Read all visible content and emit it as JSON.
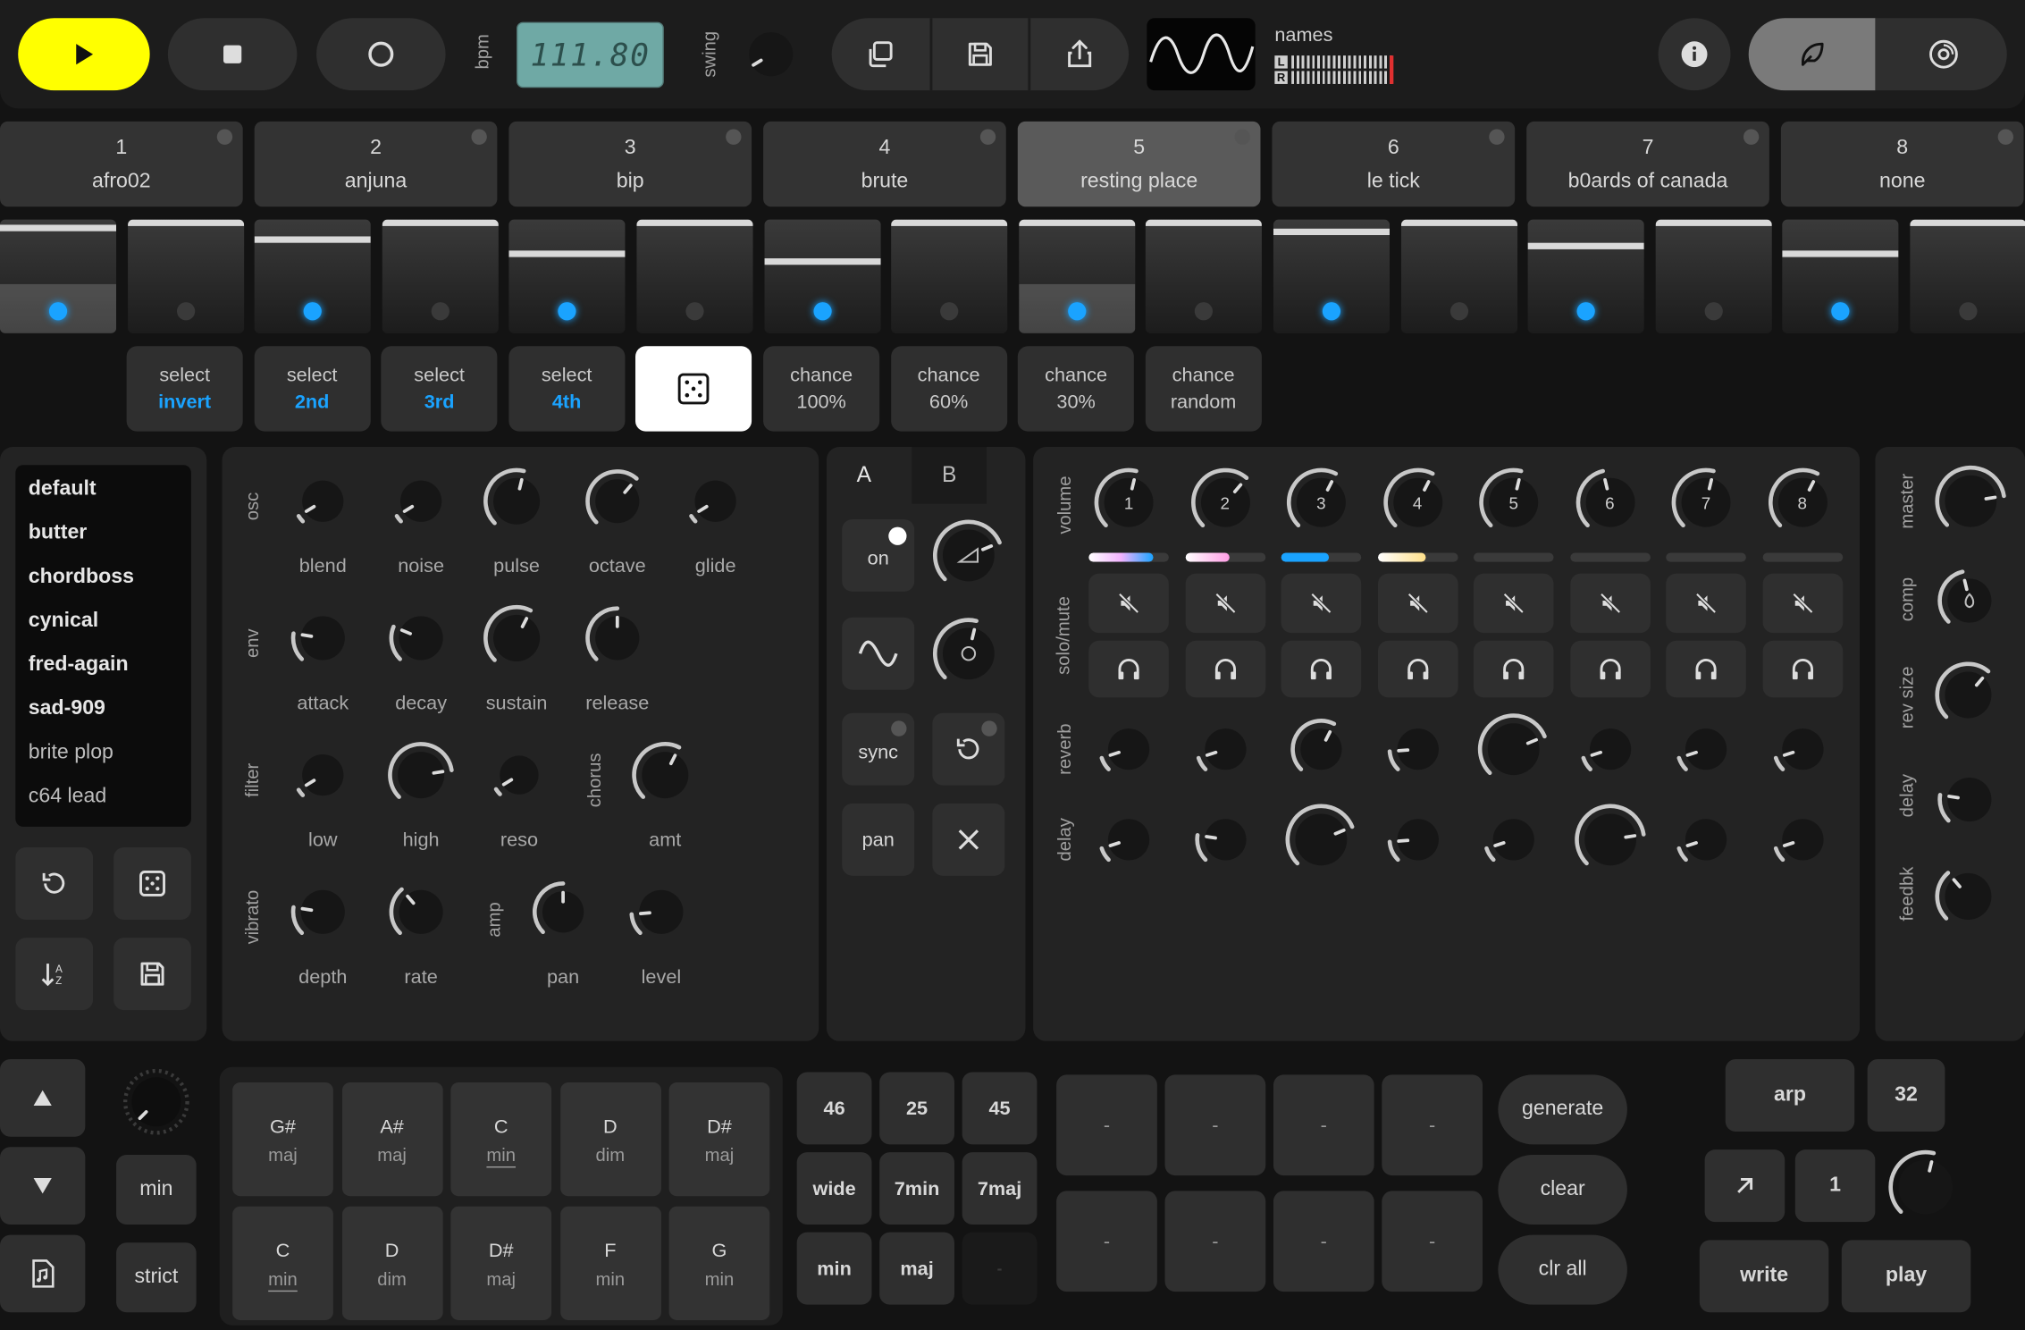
{
  "transport": {
    "bpm_label": "bpm",
    "bpm_value": "111.80",
    "swing_label": "swing",
    "scope_label": "names",
    "meter_l": "L",
    "meter_r": "R"
  },
  "colors": {
    "accent": "#1aa3ff",
    "play": "#ffff00",
    "bpm_display": "#6fa9a5",
    "bg": "#131313",
    "panel": "#232323"
  },
  "tracks": [
    {
      "num": "1",
      "name": "afro02"
    },
    {
      "num": "2",
      "name": "anjuna"
    },
    {
      "num": "3",
      "name": "bip"
    },
    {
      "num": "4",
      "name": "brute"
    },
    {
      "num": "5",
      "name": "resting place"
    },
    {
      "num": "6",
      "name": "le tick"
    },
    {
      "num": "7",
      "name": "b0ards of canada"
    },
    {
      "num": "8",
      "name": "none"
    }
  ],
  "active_track": 5,
  "step_levels": [
    0.93,
    1.0,
    0.78,
    1.0,
    0.6,
    1.0,
    0.5,
    1.0,
    1.0,
    1.0,
    0.88,
    1.0,
    0.7,
    1.0,
    0.6,
    1.0
  ],
  "select_buttons": [
    {
      "top": "select",
      "bottom": "invert"
    },
    {
      "top": "select",
      "bottom": "2nd"
    },
    {
      "top": "select",
      "bottom": "3rd"
    },
    {
      "top": "select",
      "bottom": "4th"
    }
  ],
  "chance_buttons": [
    {
      "top": "chance",
      "bottom": "100%"
    },
    {
      "top": "chance",
      "bottom": "60%"
    },
    {
      "top": "chance",
      "bottom": "30%"
    },
    {
      "top": "chance",
      "bottom": "random"
    }
  ],
  "presets": [
    "default",
    "butter",
    "chordboss",
    "cynical",
    "fred-again",
    "sad-909",
    "brite plop",
    "c64 lead"
  ],
  "synth": {
    "osc_label": "osc",
    "env_label": "env",
    "filter_label": "filter",
    "vibrato_label": "vibrato",
    "chorus_label": "chorus",
    "amp_label": "amp",
    "knobs": {
      "blend": "blend",
      "noise": "noise",
      "pulse": "pulse",
      "octave": "octave",
      "glide": "glide",
      "attack": "attack",
      "decay": "decay",
      "sustain": "sustain",
      "release": "release",
      "low": "low",
      "high": "high",
      "reso": "reso",
      "amt": "amt",
      "depth": "depth",
      "rate": "rate",
      "pan": "pan",
      "level": "level"
    }
  },
  "lfo": {
    "tab_a": "A",
    "tab_b": "B",
    "on": "on",
    "sync": "sync",
    "pan": "pan"
  },
  "mixer": {
    "volume_label": "volume",
    "solo_mute_label": "solo/mute",
    "reverb_label": "reverb",
    "delay_label": "delay",
    "channels": [
      "1",
      "2",
      "3",
      "4",
      "5",
      "6",
      "7",
      "8"
    ],
    "volume_levels": [
      0.8,
      0.55,
      0.6,
      0.6,
      0.0,
      0.0,
      0.0,
      0.0
    ]
  },
  "master": {
    "master_label": "master",
    "comp_label": "comp",
    "rev_size_label": "rev size",
    "delay_label": "delay",
    "feedbk_label": "feedbk"
  },
  "chords": {
    "row1": [
      {
        "root": "G#",
        "qual": "maj"
      },
      {
        "root": "A#",
        "qual": "maj"
      },
      {
        "root": "C",
        "qual": "min",
        "u": true
      },
      {
        "root": "D",
        "qual": "dim"
      },
      {
        "root": "D#",
        "qual": "maj"
      }
    ],
    "row2": [
      {
        "root": "C",
        "qual": "min",
        "u": true
      },
      {
        "root": "D",
        "qual": "dim"
      },
      {
        "root": "D#",
        "qual": "maj"
      },
      {
        "root": "F",
        "qual": "min"
      },
      {
        "root": "G",
        "qual": "min"
      }
    ],
    "min_label": "min",
    "strict_label": "strict"
  },
  "voicing": {
    "b1": "46",
    "b2": "25",
    "b3": "45",
    "b4": "wide",
    "b5": "7min",
    "b6": "7maj",
    "b7": "min",
    "b8": "maj",
    "b9": "-"
  },
  "slots": [
    "-",
    "-",
    "-",
    "-",
    "-",
    "-",
    "-",
    "-"
  ],
  "actions": {
    "generate": "generate",
    "clear": "clear",
    "clr_all": "clr all"
  },
  "arp": {
    "arp": "arp",
    "steps": "32",
    "one": "1",
    "write": "write",
    "play": "play"
  }
}
